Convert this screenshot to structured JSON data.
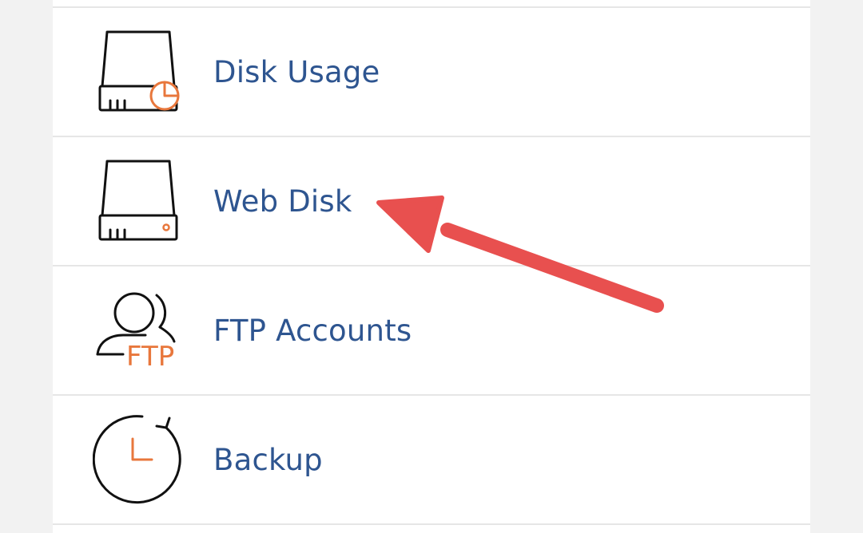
{
  "menu": {
    "items": [
      {
        "label": "Disk Usage",
        "icon": "disk-usage-icon"
      },
      {
        "label": "Web Disk",
        "icon": "web-disk-icon"
      },
      {
        "label": "FTP Accounts",
        "icon": "ftp-accounts-icon",
        "icon_text": "FTP"
      },
      {
        "label": "Backup",
        "icon": "backup-icon"
      }
    ]
  },
  "colors": {
    "label": "#2e5590",
    "icon_accent": "#e8773c",
    "icon_stroke": "#111111",
    "arrow": "#e8504f",
    "divider": "#e6e6e6"
  }
}
